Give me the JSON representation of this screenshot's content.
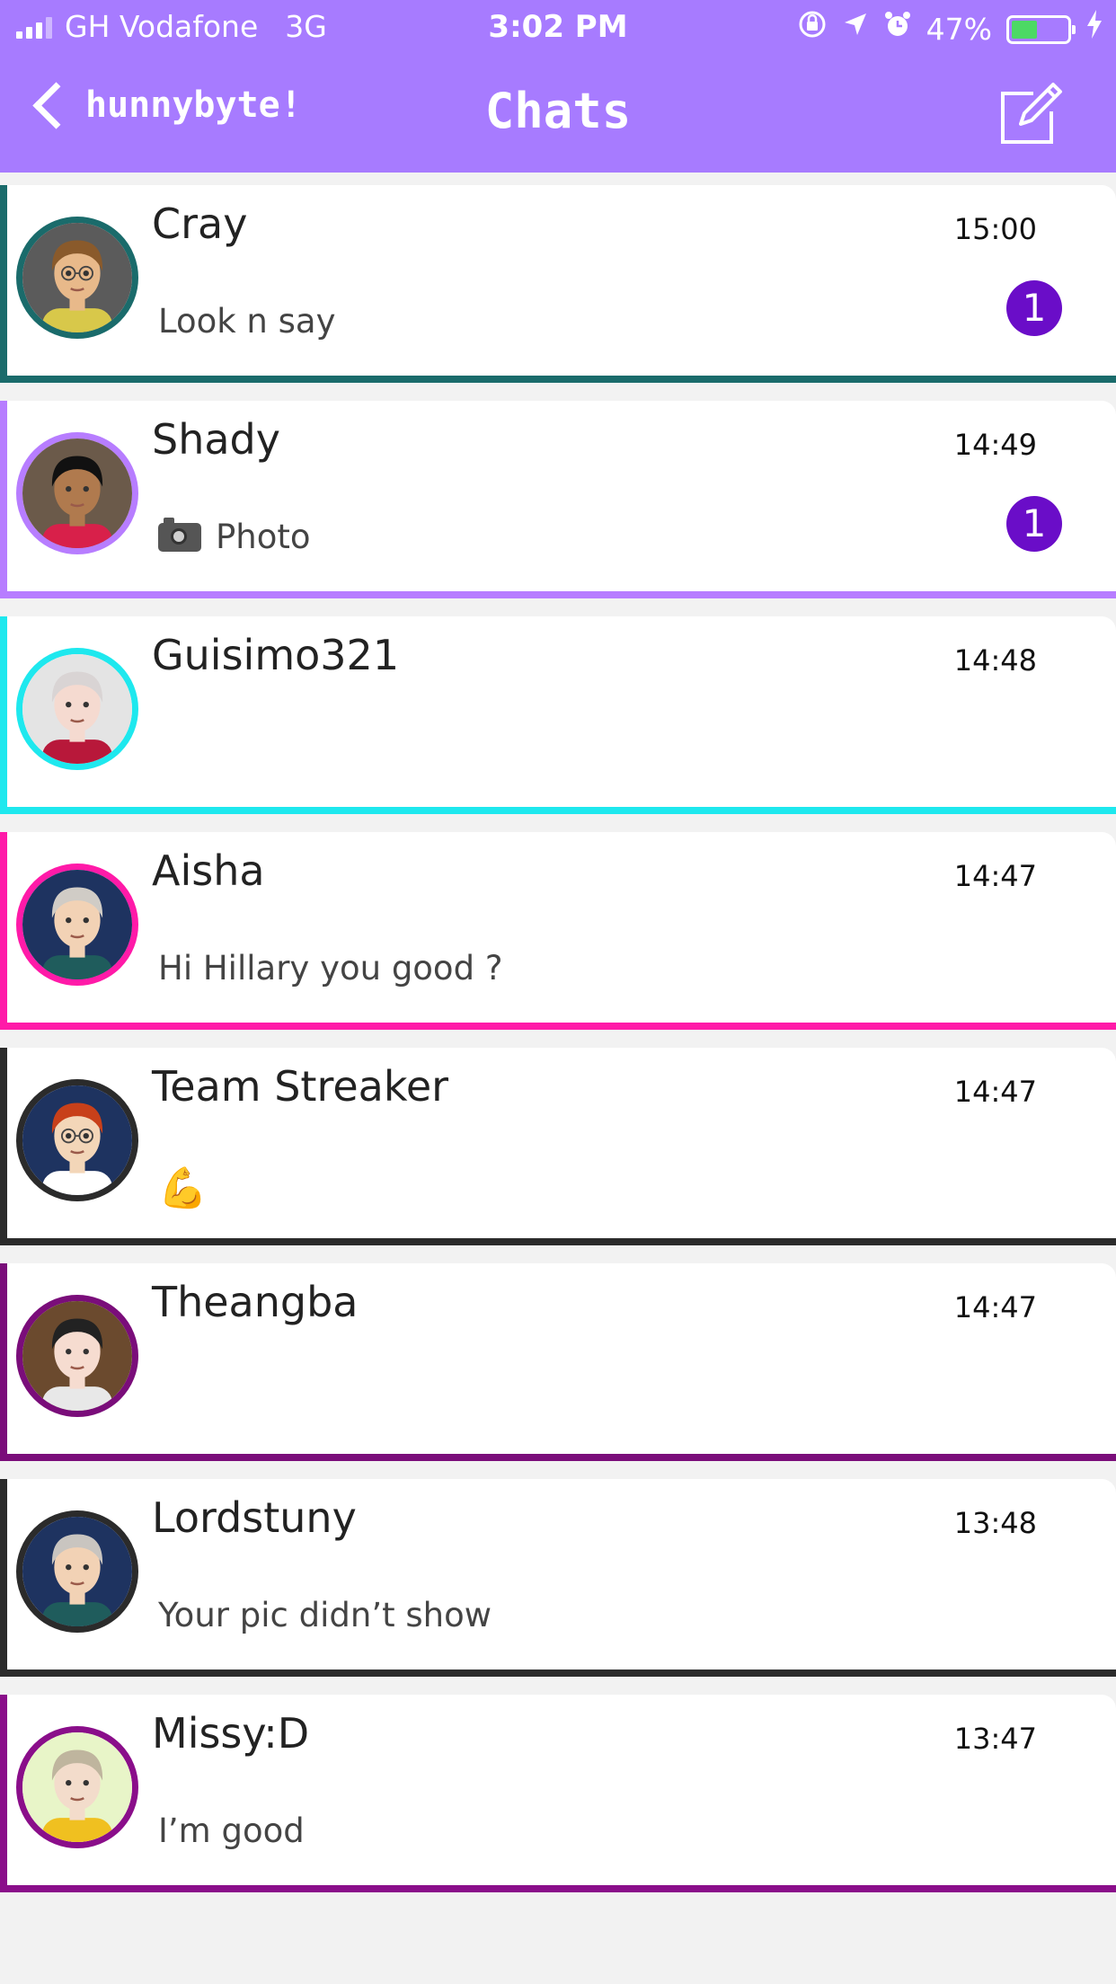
{
  "status_bar": {
    "carrier": "GH Vodafone",
    "network": "3G",
    "time": "3:02 PM",
    "battery_percent": "47%",
    "battery_level": 0.47,
    "icons": [
      "rotation-lock-icon",
      "location-icon",
      "alarm-icon",
      "charging-icon"
    ]
  },
  "nav": {
    "back_label": "hunnybyte!",
    "title": "Chats",
    "compose_icon": "compose-icon"
  },
  "colors": {
    "header": "#a77bff",
    "badge": "#6a0dc8"
  },
  "chats": [
    {
      "name": "Cray",
      "time": "15:00",
      "preview": "Look n say",
      "unread": "1",
      "accent": "#1a6b6b",
      "avatar": {
        "skin": "#e8b98a",
        "hair": "#8a5a2b",
        "shirt": "#d8c84a",
        "bg": "#5b5b5b",
        "glasses": true
      }
    },
    {
      "name": "Shady",
      "time": "14:49",
      "preview": "Photo",
      "preview_icon": "camera-icon",
      "unread": "1",
      "accent": "#b77dff",
      "avatar": {
        "skin": "#b07a4e",
        "hair": "#111111",
        "shirt": "#d8204a",
        "bg": "#6b5a4a",
        "glasses": false
      }
    },
    {
      "name": "Guisimo321",
      "time": "14:48",
      "preview": "",
      "unread": "",
      "accent": "#1ee8ee",
      "avatar": {
        "skin": "#f5dad0",
        "hair": "#d9d4d4",
        "shirt": "#b8183a",
        "bg": "#e4e4e4",
        "glasses": false
      }
    },
    {
      "name": "Aisha",
      "time": "14:47",
      "preview": "Hi Hillary you good ?",
      "unread": "",
      "accent": "#ff1aa8",
      "avatar": {
        "skin": "#f2d2b5",
        "hair": "#d0ccc6",
        "shirt": "#1f5c5c",
        "bg": "#1e3360",
        "glasses": false
      }
    },
    {
      "name": "Team Streaker",
      "time": "14:47",
      "preview": "💪",
      "unread": "",
      "accent": "#2b2b2b",
      "avatar": {
        "skin": "#f3d6b8",
        "hair": "#c8401a",
        "shirt": "#ffffff",
        "bg": "#1e3360",
        "glasses": true
      }
    },
    {
      "name": "Theangba",
      "time": "14:47",
      "preview": "",
      "unread": "",
      "accent": "#7a0d7a",
      "avatar": {
        "skin": "#f6dcd0",
        "hair": "#222222",
        "shirt": "#e8e8e8",
        "bg": "#6b4a2e",
        "glasses": false
      }
    },
    {
      "name": "Lordstuny",
      "time": "13:48",
      "preview": "Your pic didn’t show",
      "unread": "",
      "accent": "#2b2b2b",
      "avatar": {
        "skin": "#f2d2b5",
        "hair": "#c9c5c0",
        "shirt": "#1f5c5c",
        "bg": "#1e3360",
        "glasses": false
      }
    },
    {
      "name": "Missy:D",
      "time": "13:47",
      "preview": "I’m good",
      "unread": "",
      "accent": "#8a0e8a",
      "avatar": {
        "skin": "#f3dccb",
        "hair": "#bfb59e",
        "shirt": "#f0c020",
        "bg": "#e8f5c8",
        "glasses": false
      }
    }
  ]
}
